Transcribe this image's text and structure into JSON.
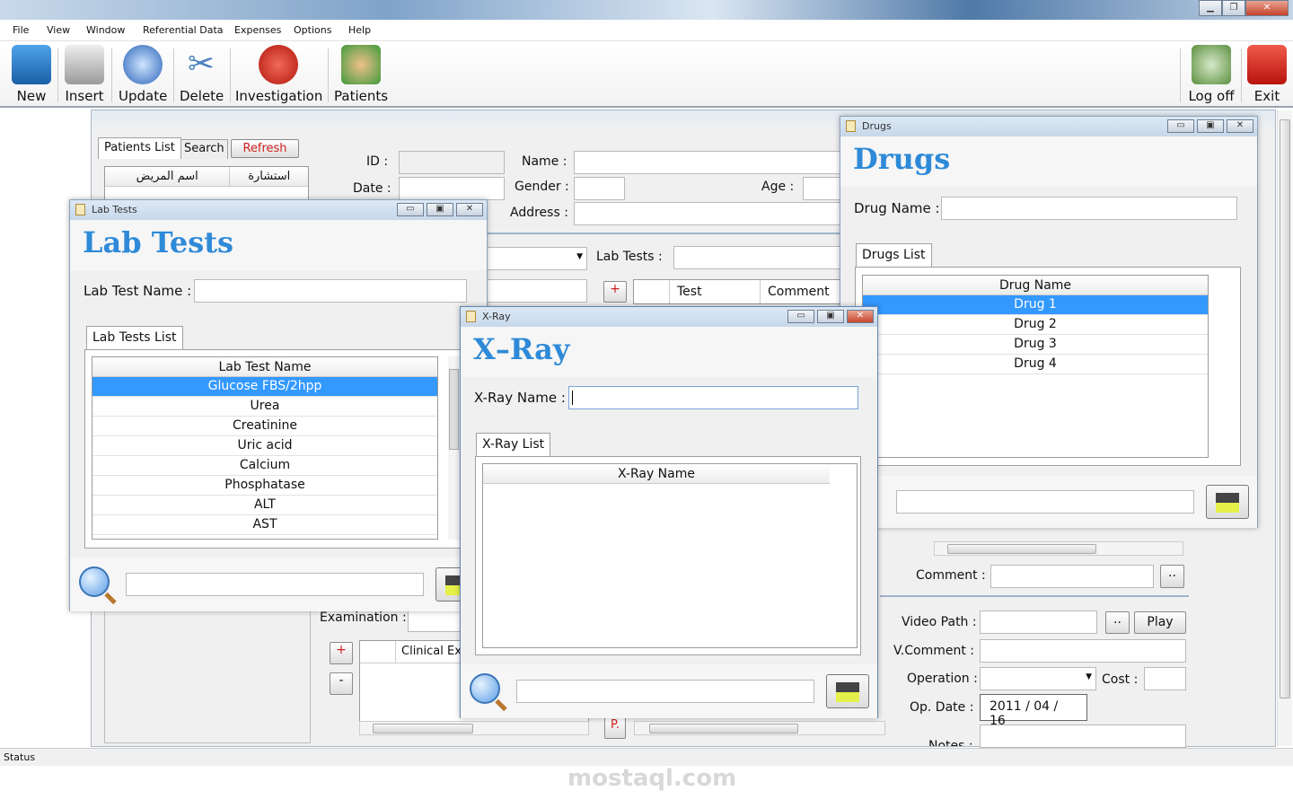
{
  "window": {
    "controls": [
      "minimize",
      "maximize",
      "close"
    ]
  },
  "menu": [
    "File",
    "View",
    "Window",
    "Referential Data",
    "Expenses",
    "Options",
    "Help"
  ],
  "toolbar": {
    "new": "New",
    "insert": "Insert",
    "update": "Update",
    "delete": "Delete",
    "investigation": "Investigation",
    "patients": "Patients",
    "logoff": "Log off",
    "exit": "Exit"
  },
  "main": {
    "tabs": {
      "patients_list": "Patients List",
      "search": "Search",
      "refresh": "Refresh"
    },
    "patients_columns": [
      "اسم المريض",
      "استشارة"
    ],
    "labels": {
      "id": "ID :",
      "name": "Name :",
      "date": "Date :",
      "gender": "Gender :",
      "age": "Age :",
      "address": "Address :",
      "lab_tests": "Lab Tests :",
      "test": "Test",
      "comment_col": "Comment",
      "comment": "Comment :",
      "video_path": "Video Path :",
      "vcomment": "V.Comment :",
      "operation": "Operation :",
      "cost": "Cost :",
      "op_date": "Op. Date :",
      "notes": "Notes :",
      "examination": "Examination :",
      "clinical": "Clinical Exa",
      "plus": "+",
      "minus": "-",
      "p": "P.",
      "dots": "..",
      "play": "Play"
    },
    "op_date_value": "2011 / 04 / 16"
  },
  "lab_tests": {
    "title": "Lab Tests",
    "heading": "Lab Tests",
    "name_label": "Lab Test Name :",
    "list_tab": "Lab Tests List",
    "column": "Lab Test Name",
    "items": [
      "Glucose FBS/2hpp",
      "Urea",
      "Creatinine",
      "Uric acid",
      "Calcium",
      "Phosphatase",
      "ALT",
      "AST"
    ],
    "selected": "Glucose FBS/2hpp"
  },
  "xray": {
    "title": "X-Ray",
    "heading": "X–Ray",
    "name_label": "X-Ray Name :",
    "list_tab": "X-Ray List",
    "column": "X-Ray Name"
  },
  "drugs": {
    "title": "Drugs",
    "heading": "Drugs",
    "name_label": "Drug Name :",
    "list_tab": "Drugs List",
    "column": "Drug Name",
    "items": [
      "Drug 1",
      "Drug 2",
      "Drug 3",
      "Drug 4"
    ],
    "selected": "Drug 1"
  },
  "status": "Status",
  "watermark": "mostaql.com",
  "colors": {
    "accent": "#2e8ad8",
    "selection": "#3399ff",
    "refresh": "#d02020"
  }
}
